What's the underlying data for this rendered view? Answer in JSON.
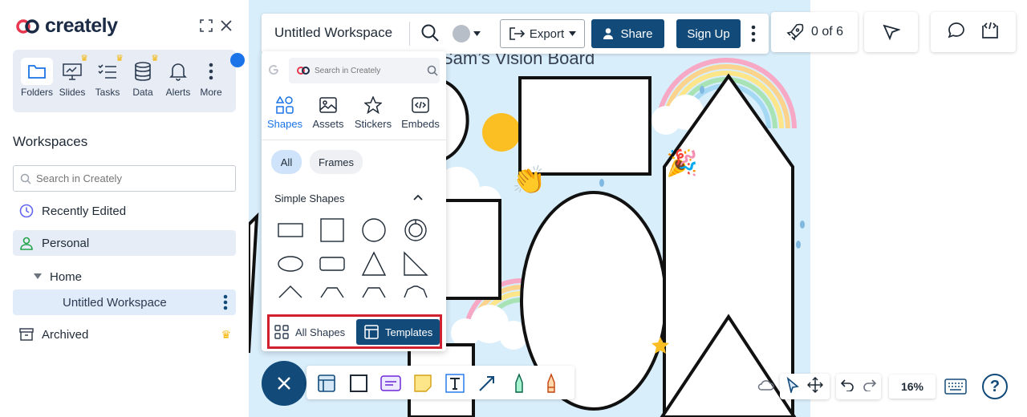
{
  "app": {
    "logo_text": "creately",
    "brand_color": "#124a7a",
    "accent_color": "#1a73e8",
    "highlight_color": "#d1202f"
  },
  "sidebar": {
    "nav_items": [
      {
        "label": "Folders",
        "icon": "folder-icon",
        "active": true,
        "premium": false
      },
      {
        "label": "Slides",
        "icon": "presentation-icon",
        "premium": true
      },
      {
        "label": "Tasks",
        "icon": "checklist-icon",
        "premium": true
      },
      {
        "label": "Data",
        "icon": "database-icon",
        "premium": true
      },
      {
        "label": "Alerts",
        "icon": "bell-icon",
        "premium": false
      },
      {
        "label": "More",
        "icon": "more-vertical-icon",
        "premium": false
      }
    ],
    "workspaces_title": "Workspaces",
    "search_placeholder": "Search in Creately",
    "recently_edited": "Recently Edited",
    "personal": "Personal",
    "home": "Home",
    "current_workspace": "Untitled Workspace",
    "archived": "Archived"
  },
  "topbar": {
    "workspace_name": "Untitled Workspace",
    "export_label": "Export",
    "share_label": "Share",
    "signup_label": "Sign Up",
    "progress_label": "0 of 6"
  },
  "canvas": {
    "board_title": "Sam’s Vision Board"
  },
  "shapes_panel": {
    "search_placeholder": "Search in Creately",
    "tabs": [
      "Shapes",
      "Assets",
      "Stickers",
      "Embeds"
    ],
    "active_tab": "Shapes",
    "chips": [
      "All",
      "Frames"
    ],
    "section_title": "Simple Shapes",
    "all_shapes_label": "All Shapes",
    "templates_label": "Templates"
  },
  "bottom": {
    "zoom_level": "16%"
  }
}
